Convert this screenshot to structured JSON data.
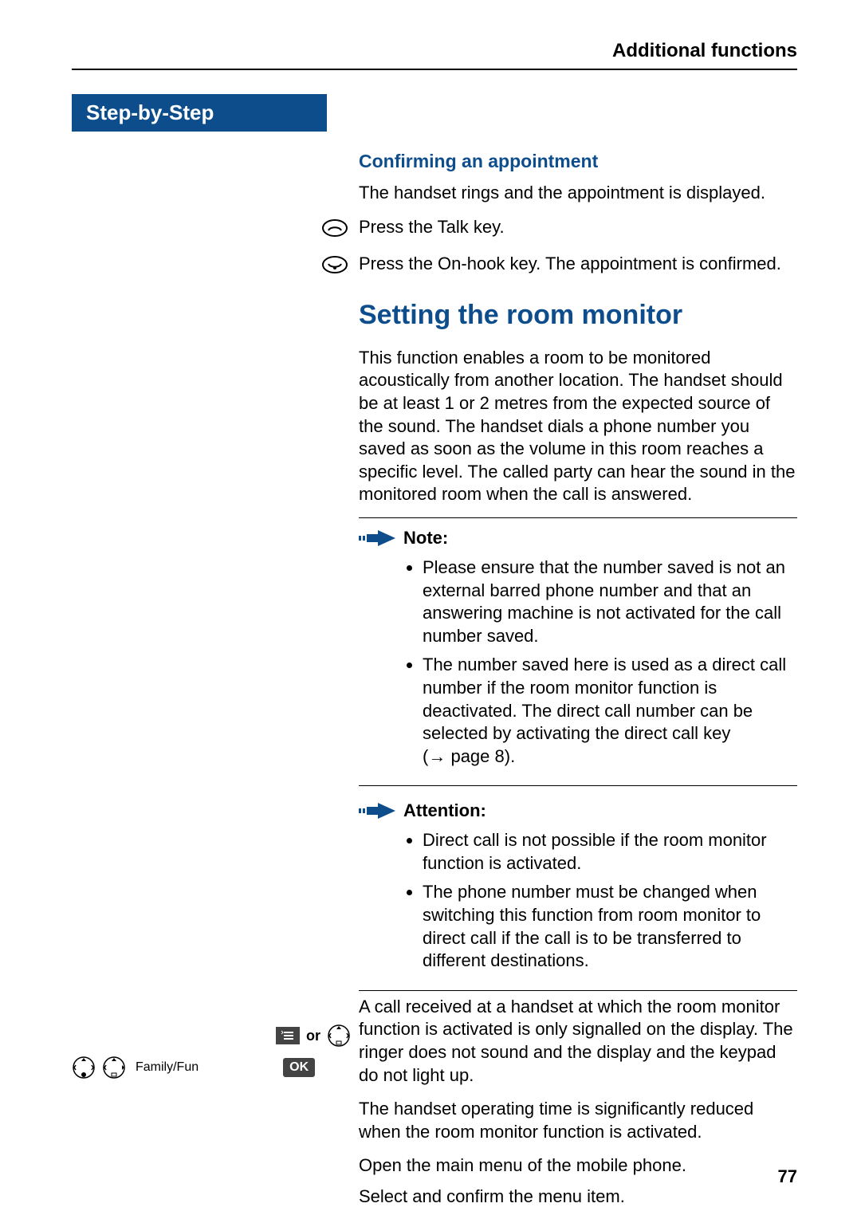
{
  "header": {
    "section": "Additional functions"
  },
  "stepBox": "Step-by-Step",
  "confirm": {
    "heading": "Confirming an appointment",
    "intro": "The handset rings and the appointment is displayed.",
    "talk": "Press the Talk key.",
    "onhook": "Press the On-hook key. The appointment is confirmed."
  },
  "roomMonitor": {
    "heading": "Setting the room monitor",
    "para1": "This function enables a room to be monitored acoustically from another location. The handset should be at least 1 or 2 metres from the expected source of the sound. The handset dials a phone number you saved as soon as the volume in this room reaches a specific level. The called party can hear the sound in the monitored room when the call is answered.",
    "note": {
      "title": "Note:",
      "items": [
        "Please ensure that the number saved is not an external barred phone number and that an answering machine is not activated for the call number saved.",
        "The number saved here is used as a direct call number if the room monitor function is deactivated. The direct call number can be selected by activating the direct call key"
      ],
      "crossref": "page 8)."
    },
    "attention": {
      "title": "Attention:",
      "items": [
        "Direct call is not possible if the room monitor function is activated.",
        "The phone number must be changed when switching this function from room monitor to direct call if the call is to be transferred to different destinations."
      ]
    },
    "para2": "A call received at a handset at which the room monitor function is activated is only signalled on the display. The ringer does not sound and the display and the keypad do not light up.",
    "para3": "The handset operating time is significantly reduced when the room monitor function is activated.",
    "openMenu": "Open the main menu of the mobile phone.",
    "selectConfirm": "Select and confirm the menu item."
  },
  "leftGuide": {
    "or": "or",
    "family": "Family/Fun",
    "ok": "OK"
  },
  "pageNumber": "77"
}
